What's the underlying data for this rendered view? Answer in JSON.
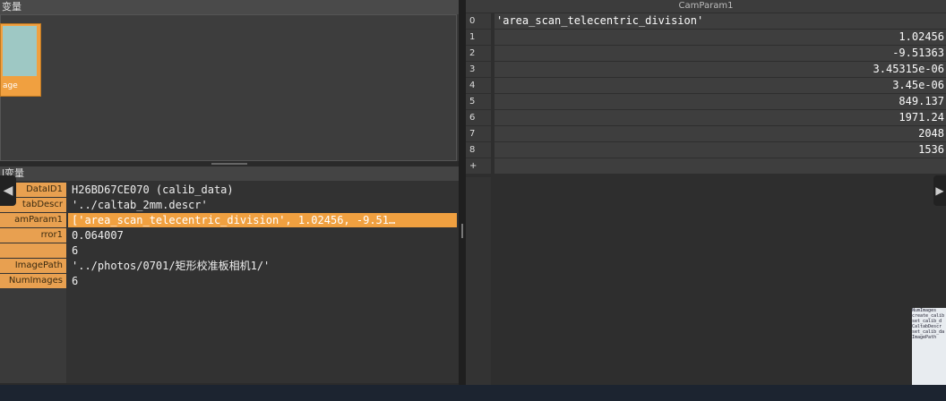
{
  "image_panel": {
    "header": "变量",
    "thumbnail_label": "age"
  },
  "control_panel": {
    "header": "l变量",
    "rows": [
      {
        "name": "DataID1",
        "value": "H26BD67CE070 (calib_data)"
      },
      {
        "name": "tabDescr",
        "value": "'../caltab_2mm.descr'"
      },
      {
        "name": "amParam1",
        "value": "['area_scan_telecentric_division', 1.02456, -9.51…"
      },
      {
        "name": "rror1",
        "value": "0.064007"
      },
      {
        "name": "",
        "value": "6"
      },
      {
        "name": "ImagePath",
        "value": "'../photos/0701/矩形校准板相机1/'"
      },
      {
        "name": "NumImages",
        "value": "6"
      }
    ]
  },
  "cam_param": {
    "title": "CamParam1",
    "rows": [
      {
        "index": "0",
        "value": "'area_scan_telecentric_division'"
      },
      {
        "index": "1",
        "value": "1.02456"
      },
      {
        "index": "2",
        "value": "-9.51363"
      },
      {
        "index": "3",
        "value": "3.45315e-06"
      },
      {
        "index": "4",
        "value": "3.45e-06"
      },
      {
        "index": "5",
        "value": "849.137"
      },
      {
        "index": "6",
        "value": "1971.24"
      },
      {
        "index": "7",
        "value": "2048"
      },
      {
        "index": "8",
        "value": "1536"
      },
      {
        "index": "+",
        "value": ""
      }
    ]
  },
  "nav": {
    "left_arrow": "◀",
    "right_arrow": "▶"
  },
  "mini_code": [
    "NumImages",
    "create_calib",
    "set_calib_d",
    "CaltabDescr",
    "set_calib_da",
    "ImagePath"
  ]
}
